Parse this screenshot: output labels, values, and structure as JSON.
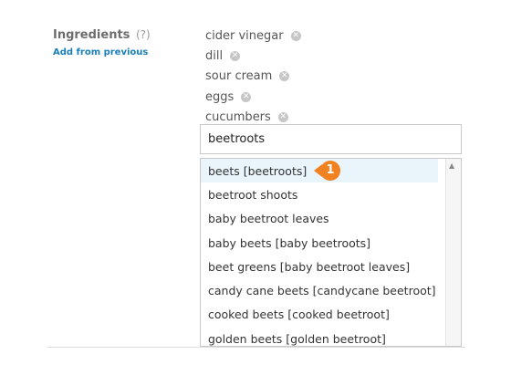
{
  "ingredients": {
    "label": "Ingredients",
    "help": "(?)",
    "add_from_previous": "Add from previous",
    "tags": [
      "cider vinegar",
      "dill",
      "sour cream",
      "eggs",
      "cucumbers"
    ],
    "remove_glyph": "✕"
  },
  "search": {
    "value": "beetroots"
  },
  "suggestions": [
    "beets [beetroots]",
    "beetroot shoots",
    "baby beetroot leaves",
    "baby beets [baby beetroots]",
    "beet greens [baby beetroot leaves]",
    "candy cane beets [candycane beetroot]",
    "cooked beets [cooked beetroot]",
    "golden beets [golden beetroot]"
  ],
  "callout": {
    "number": "1",
    "color": "#f2821f"
  },
  "colors": {
    "link": "#1a7fb8",
    "highlight": "#e9f4fb"
  }
}
